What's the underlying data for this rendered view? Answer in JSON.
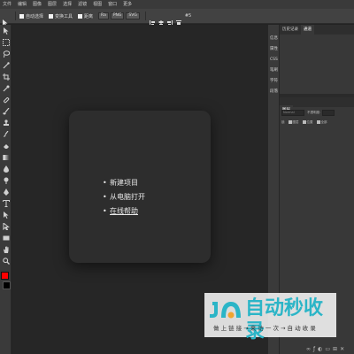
{
  "menubar": {
    "items": [
      "文件",
      "编辑",
      "图像",
      "图层",
      "选择",
      "滤镜",
      "视图",
      "窗口",
      "更多"
    ]
  },
  "options": {
    "auto_select_label": "自动选择",
    "transform_label": "变换工具",
    "distance_label": "距离",
    "format_dropdown": "Ra",
    "png_button": "PNG",
    "svg_button": "SVG",
    "extra_label": "#5"
  },
  "welcome": {
    "items": [
      "新建项目",
      "从电脑打开",
      "在线帮助"
    ]
  },
  "side_tabs": [
    "信息",
    "属性",
    "CSS",
    "笔刷",
    "字符",
    "段落"
  ],
  "panel": {
    "tabs": [
      "历史记录",
      "通道"
    ],
    "dots": "«"
  },
  "layers": {
    "tab": "图层",
    "blend_mode": "Normal",
    "opacity_label": "不透明度:",
    "lock_label": "锁",
    "actions": [
      "图层",
      "位置",
      "全部"
    ]
  },
  "swatch_label": "默认",
  "watermark": {
    "title": "自动秒收录",
    "subtitle": "做 上 链 接 → 来 访 一 次 → 自 动 收 录"
  },
  "colors": {
    "foreground": "#ff0000",
    "background": "#000000",
    "accent": "#2bb5c7"
  }
}
